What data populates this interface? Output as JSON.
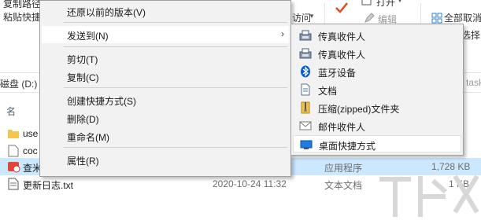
{
  "ribbon": {
    "top_left_1": "复制路径",
    "top_left_2": "粘贴快捷",
    "access_label": "访问",
    "open_label": "打开",
    "edit_label": "编辑",
    "select_all_label": "全部取消",
    "select_label": "选择"
  },
  "address": {
    "drive": "磁盘 (D:)",
    "right_fragment": "task"
  },
  "column_header": {
    "name": "名"
  },
  "files": [
    {
      "name": "use",
      "date": "",
      "type": "",
      "size": ""
    },
    {
      "name": "coc",
      "date": "",
      "type": "",
      "size": ""
    },
    {
      "name": "查米",
      "date": "",
      "type": "应用程序",
      "size": "1,728 KB"
    },
    {
      "name": "更新日志.txt",
      "date": "2020-10-24 11:32",
      "type": "文本文档",
      "size": "1 KB"
    }
  ],
  "context_menu": {
    "restore": "还原以前的版本(V)",
    "send_to": "发送到(N)",
    "cut": "剪切(T)",
    "copy": "复制(C)",
    "create_shortcut": "创建快捷方式(S)",
    "delete": "删除(D)",
    "rename": "重命名(M)",
    "properties": "属性(R)"
  },
  "send_to_menu": {
    "fax1": "传真收件人",
    "fax2": "传真收件人",
    "bluetooth": "蓝牙设备",
    "documents": "文档",
    "zip": "压缩(zipped)文件夹",
    "mail": "邮件收件人",
    "desktop": "桌面快捷方式"
  },
  "colors": {
    "selection": "#cce8ff",
    "menu_bg": "#f2f2f2",
    "accent_blue": "#0078d7"
  }
}
